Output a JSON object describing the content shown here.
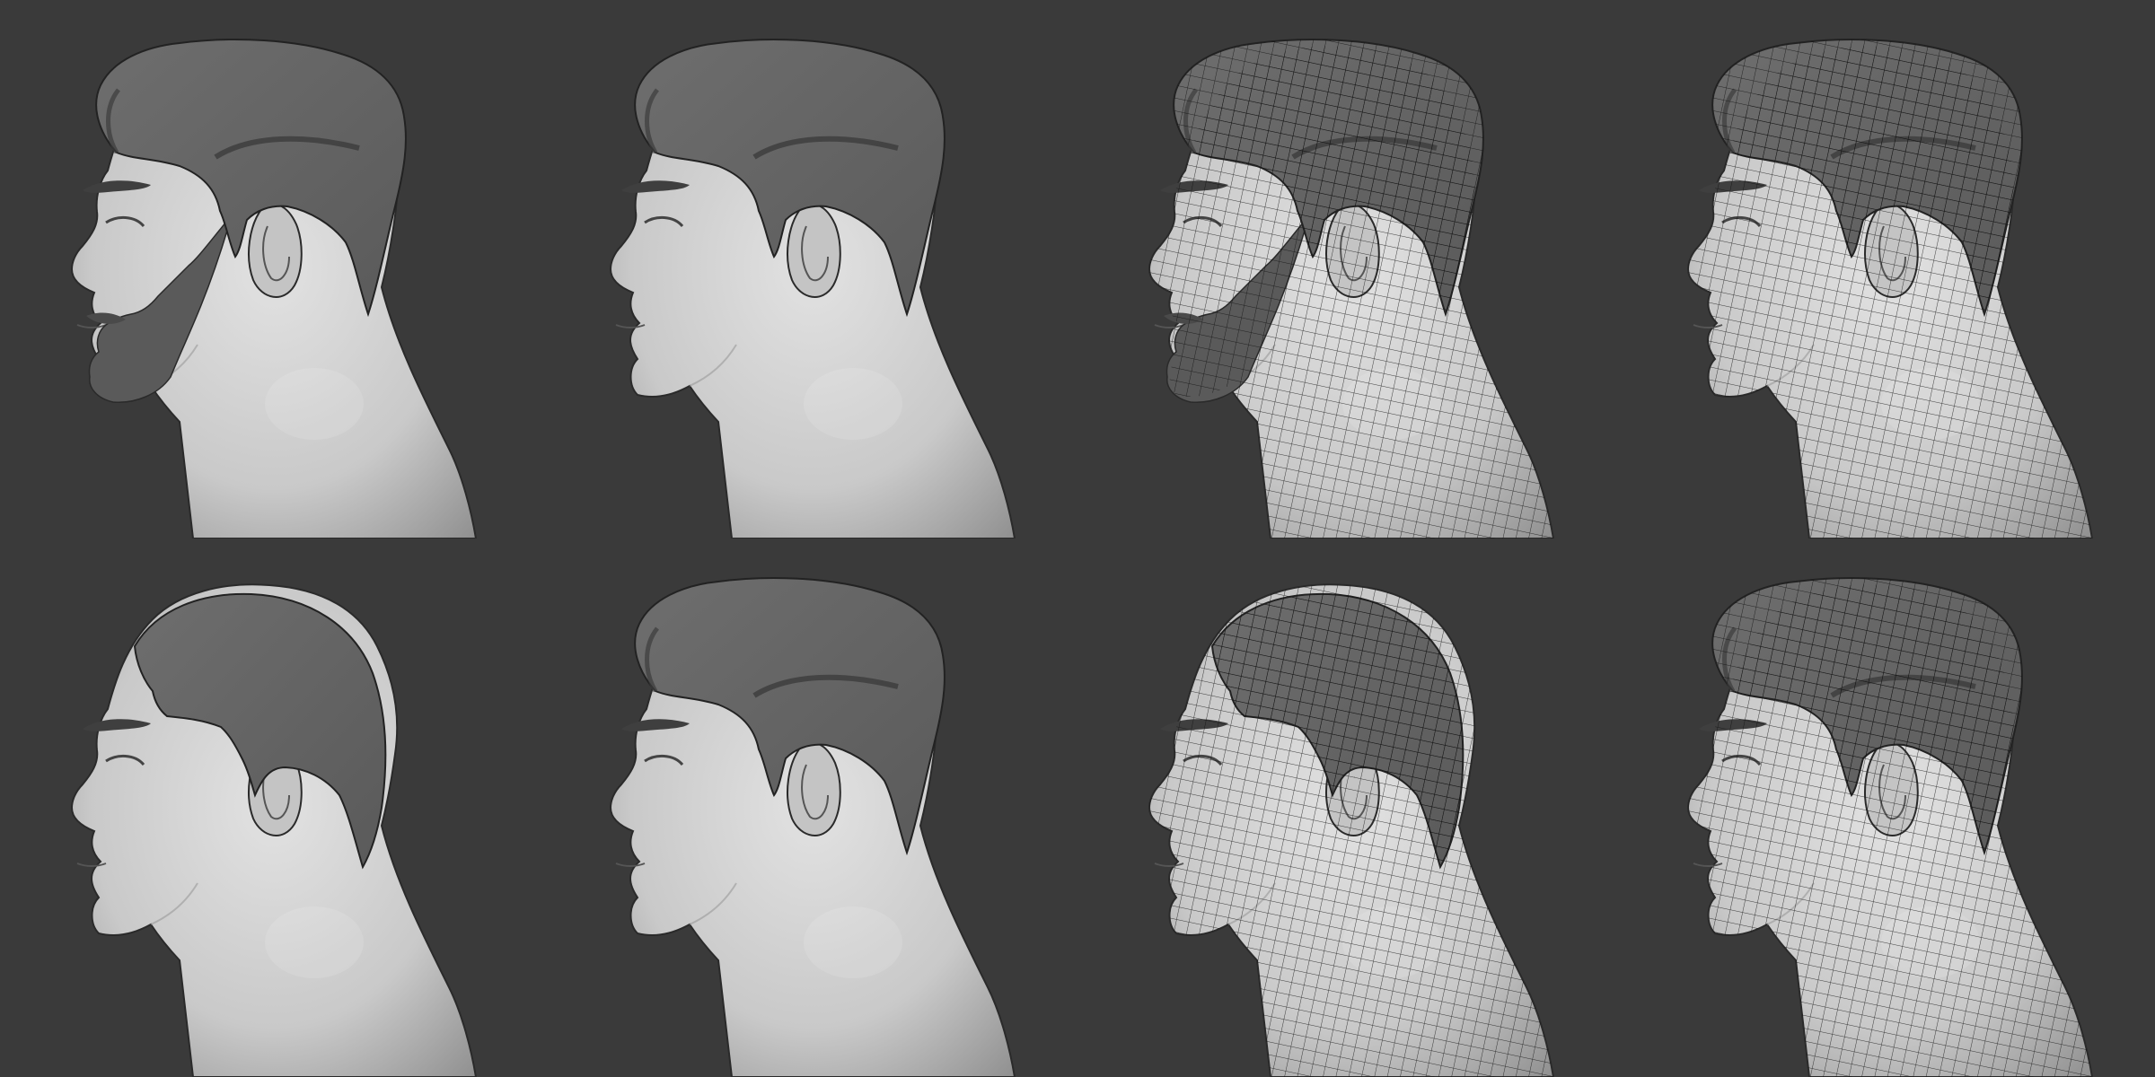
{
  "scene": {
    "background_color": "#3a3a3a",
    "skin_color": "#c9c9c9",
    "hair_color": "#5a5a5a",
    "wire_color": "#111111",
    "grid": {
      "columns": 4,
      "rows": 2
    },
    "views": [
      {
        "row": 1,
        "column": 1,
        "style": "shaded",
        "hair": "pompadour",
        "beard": true
      },
      {
        "row": 1,
        "column": 2,
        "style": "shaded",
        "hair": "pompadour",
        "beard": false
      },
      {
        "row": 1,
        "column": 3,
        "style": "wireframe",
        "hair": "pompadour",
        "beard": true
      },
      {
        "row": 1,
        "column": 4,
        "style": "wireframe",
        "hair": "pompadour",
        "beard": false
      },
      {
        "row": 2,
        "column": 1,
        "style": "shaded",
        "hair": "short",
        "beard": false
      },
      {
        "row": 2,
        "column": 2,
        "style": "shaded",
        "hair": "pompadour",
        "beard": false
      },
      {
        "row": 2,
        "column": 3,
        "style": "wireframe",
        "hair": "short",
        "beard": false
      },
      {
        "row": 2,
        "column": 4,
        "style": "wireframe",
        "hair": "pompadour",
        "beard": false
      }
    ]
  }
}
